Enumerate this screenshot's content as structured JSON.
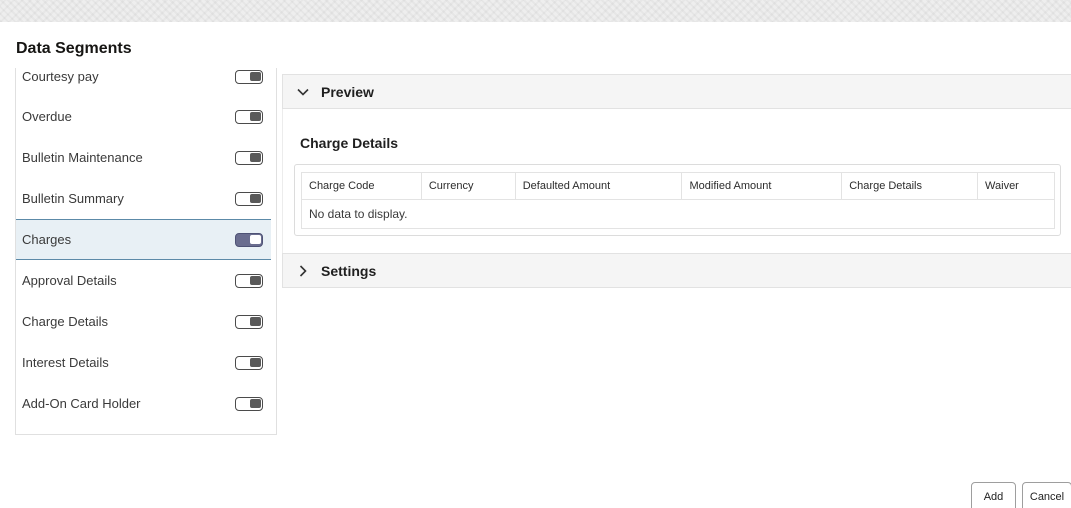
{
  "page": {
    "title": "Data Segments"
  },
  "segments": [
    {
      "label": "Courtesy pay",
      "enabled": false
    },
    {
      "label": "Overdue",
      "enabled": false
    },
    {
      "label": "Bulletin Maintenance",
      "enabled": false
    },
    {
      "label": "Bulletin Summary",
      "enabled": false
    },
    {
      "label": "Charges",
      "enabled": true,
      "selected": true
    },
    {
      "label": "Approval Details",
      "enabled": false
    },
    {
      "label": "Charge Details",
      "enabled": false
    },
    {
      "label": "Interest Details",
      "enabled": false
    },
    {
      "label": "Add-On Card Holder",
      "enabled": false
    }
  ],
  "preview": {
    "title": "Preview",
    "expanded": true,
    "section_title": "Charge Details",
    "columns": [
      "Charge Code",
      "Currency",
      "Defaulted Amount",
      "Modified Amount",
      "Charge Details",
      "Waiver"
    ],
    "empty_message": "No data to display."
  },
  "settings": {
    "title": "Settings",
    "expanded": false
  },
  "footer": {
    "add_label": "Add",
    "cancel_label": "Cancel"
  },
  "colors": {
    "toggle_on": "#6a6d8f",
    "selected_row": "#e8f0f5",
    "selected_border": "#5c8aa8"
  }
}
